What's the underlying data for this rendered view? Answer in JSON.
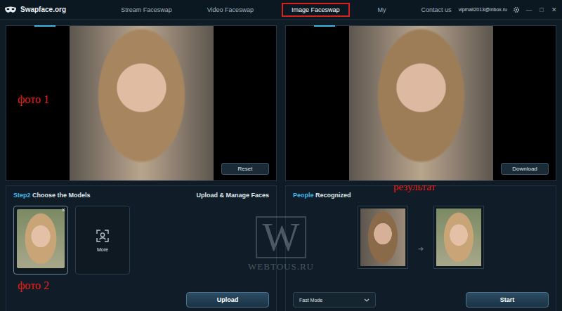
{
  "window": {
    "logo": "Swapface.org",
    "user": "vipmail2013@inbox.ru",
    "controls": [
      "—",
      "□",
      "✕"
    ]
  },
  "nav": [
    {
      "label": "Stream Faceswap",
      "selected": false
    },
    {
      "label": "Video Faceswap",
      "selected": false
    },
    {
      "label": "Image Faceswap",
      "selected": true
    },
    {
      "label": "My",
      "selected": false
    },
    {
      "label": "Contact us",
      "selected": false
    }
  ],
  "source_panel": {
    "annotation": "фото 1",
    "button": "Reset"
  },
  "result_panel": {
    "annotation": "результат",
    "button": "Download"
  },
  "models_panel": {
    "step": "Step2",
    "title": "Choose the Models",
    "link": "Upload & Manage Faces",
    "annotation": "фото 2",
    "button": "Upload",
    "models": [
      {
        "kind": "face",
        "close": "×",
        "selected": true
      },
      {
        "kind": "more",
        "label": "More",
        "selected": false
      }
    ]
  },
  "people_panel": {
    "highlight": "People",
    "title": "Recognized",
    "arrow": "➜",
    "mode": "Fast Mode",
    "button": "Start"
  },
  "watermark": {
    "mark": "W",
    "text": "WEBTOUS.RU"
  }
}
